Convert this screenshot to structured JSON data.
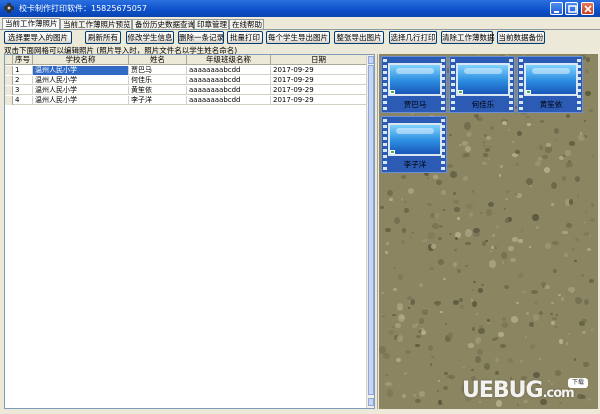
{
  "window": {
    "title": "校卡制作打印软件：15825675057",
    "icon": "app-flower-icon"
  },
  "tabs": [
    {
      "label": "当前工作薄照片",
      "active": true
    },
    {
      "label": "当前工作薄照片预览",
      "active": false
    },
    {
      "label": "备份历史数据查询",
      "active": false
    },
    {
      "label": "印章管理",
      "active": false
    },
    {
      "label": "在线帮助",
      "active": false
    }
  ],
  "toolbar": {
    "select_photos": "选择要导入的图片",
    "refresh_all": "刷新所有",
    "edit_student": "修改学生信息",
    "delete_record": "删除一条记录",
    "batch_print": "批量打印",
    "export_each": "每个学生导出图片",
    "export_sheet": "整张导出图片",
    "print_rows": "选择几行打印",
    "clear_data": "清除工作薄数据",
    "backup_data": "当前数据备份"
  },
  "info_label": "双击下面网格可以编辑照片 (照片导入时，照片文件名以学生姓名命名)",
  "grid": {
    "headers": [
      "序号",
      "学校名称",
      "姓名",
      "年级班级名称",
      "日期"
    ],
    "rows": [
      {
        "no": "1",
        "school": "温州人民小学",
        "name": "贾巴马",
        "class": "aaaaaaaabcdd",
        "date": "2017-09-29"
      },
      {
        "no": "2",
        "school": "温州人民小学",
        "name": "何佳乐",
        "class": "aaaaaaaabcdd",
        "date": "2017-09-29"
      },
      {
        "no": "3",
        "school": "温州人民小学",
        "name": "黄笙依",
        "class": "aaaaaaaabcdd",
        "date": "2017-09-29"
      },
      {
        "no": "4",
        "school": "温州人民小学",
        "name": "李子洋",
        "class": "aaaaaaaabcdd",
        "date": "2017-09-29"
      }
    ]
  },
  "photos": [
    {
      "name": "贾巴马"
    },
    {
      "name": "何佳乐"
    },
    {
      "name": "黄笙依"
    },
    {
      "name": "李子洋"
    }
  ],
  "watermark": {
    "text": "UEBUG",
    "suffix": ".com",
    "badge": "下载"
  }
}
